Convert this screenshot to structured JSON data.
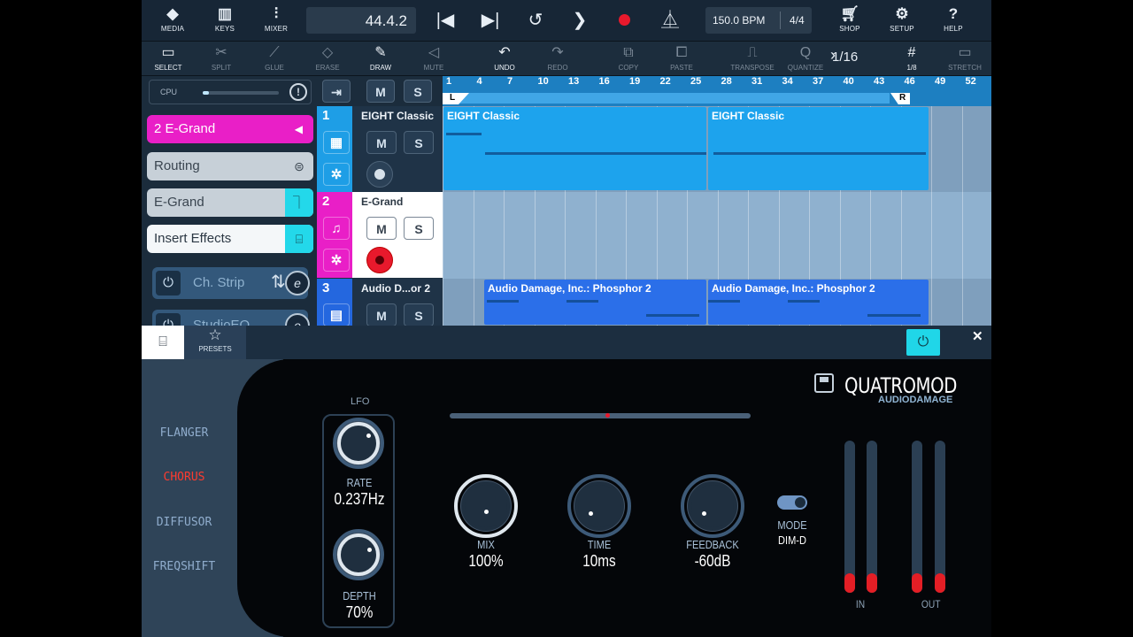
{
  "topbar": {
    "buttons": [
      {
        "label": "MEDIA",
        "icon": "media-icon"
      },
      {
        "label": "KEYS",
        "icon": "keys-icon"
      },
      {
        "label": "MIXER",
        "icon": "mixer-icon"
      }
    ],
    "position": "44.4.2",
    "tempo": "150.0 BPM",
    "time_signature": "4/4",
    "right_buttons": [
      {
        "label": "SHOP",
        "icon": "cart-icon"
      },
      {
        "label": "SETUP",
        "icon": "gear-icon"
      },
      {
        "label": "HELP",
        "icon": "help-icon"
      }
    ]
  },
  "tools": [
    {
      "label": "SELECT",
      "active": true
    },
    {
      "label": "SPLIT"
    },
    {
      "label": "GLUE"
    },
    {
      "label": "ERASE"
    },
    {
      "label": "DRAW",
      "active": true
    },
    {
      "label": "MUTE"
    },
    {
      "label": "UNDO",
      "active": true
    },
    {
      "label": "REDO"
    },
    {
      "label": "COPY"
    },
    {
      "label": "PASTE"
    },
    {
      "label": "TRANSPOSE"
    },
    {
      "label": "QUANTIZE"
    },
    {
      "label": "1/8",
      "active": true
    },
    {
      "label": "STRETCH"
    }
  ],
  "quantize_value": "1/16",
  "inspector": {
    "cpu_label": "CPU",
    "track_label": "2  E-Grand",
    "routing_label": "Routing",
    "instrument_label": "E-Grand",
    "insert_effects_label": "Insert Effects",
    "fx_slots": [
      "Ch. Strip",
      "StudioEQ"
    ]
  },
  "track_header_buttons": {
    "mute": "M",
    "solo": "S"
  },
  "tracks": [
    {
      "number": "1",
      "name": "EIGHT Classic",
      "color": "#1e9ee6"
    },
    {
      "number": "2",
      "name": "E-Grand",
      "color": "#e91fc7"
    },
    {
      "number": "3",
      "name": "Audio D...or 2",
      "color": "#2467df"
    }
  ],
  "ruler": {
    "bars": [
      "1",
      "4",
      "7",
      "10",
      "13",
      "16",
      "19",
      "22",
      "25",
      "28",
      "31",
      "34",
      "37",
      "40",
      "43",
      "46",
      "49",
      "52"
    ],
    "loop_start_label": "L",
    "loop_end_label": "R"
  },
  "clips": [
    {
      "track": 1,
      "name": "EIGHT Classic"
    },
    {
      "track": 1,
      "name": "EIGHT Classic"
    },
    {
      "track": 3,
      "name": "Audio Damage, Inc.: Phosphor 2"
    },
    {
      "track": 3,
      "name": "Audio Damage, Inc.: Phosphor 2"
    }
  ],
  "plugin_tabs": {
    "presets_label": "PRESETS"
  },
  "plugin": {
    "brand": "QUATROMOD",
    "maker": "AUDIODAMAGE",
    "modes": [
      "FLANGER",
      "CHORUS",
      "DIFFUSOR",
      "FREQSHIFT"
    ],
    "active_mode": "CHORUS",
    "lfo_label": "LFO",
    "rate": {
      "label": "RATE",
      "value": "0.237Hz"
    },
    "depth": {
      "label": "DEPTH",
      "value": "70%"
    },
    "mix": {
      "label": "MIX",
      "value": "100%"
    },
    "time": {
      "label": "TIME",
      "value": "10ms"
    },
    "feedback": {
      "label": "FEEDBACK",
      "value": "-60dB"
    },
    "mode": {
      "label": "MODE",
      "value": "DIM-D"
    },
    "meters": {
      "in_label": "IN",
      "out_label": "OUT"
    },
    "accent_color": "#20d6e8",
    "active_mode_color": "#ff3b2f"
  }
}
